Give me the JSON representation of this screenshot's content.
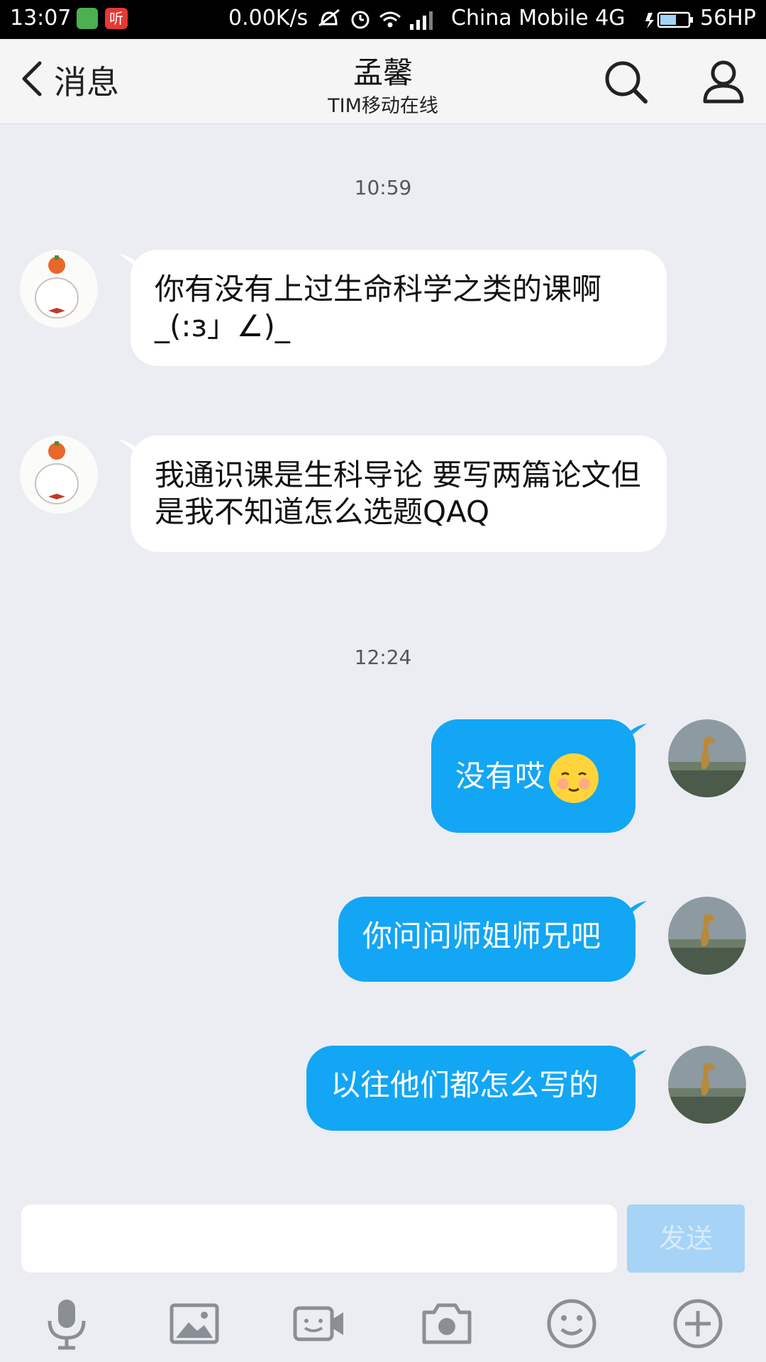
{
  "status_bar": {
    "time": "13:07",
    "app2_label": "听",
    "speed": "0.00K/s",
    "carrier": "China Mobile 4G",
    "battery": "56HP"
  },
  "header": {
    "back_label": "消息",
    "title": "孟馨",
    "subtitle": "TIM移动在线"
  },
  "chat": {
    "time1": "10:59",
    "msg1": "你有没有上过生命科学之类的课啊_(:з」∠)_",
    "msg2": "我通识课是生科导论 要写两篇论文但是我不知道怎么选题QAQ",
    "time2": "12:24",
    "msg3": "没有哎",
    "msg4": "你问问师姐师兄吧",
    "msg5": "以往他们都怎么写的"
  },
  "input": {
    "value": "",
    "send_label": "发送"
  },
  "colors": {
    "accent": "#12a6f5",
    "background": "#ebedf2",
    "send_disabled": "#a7d3f7"
  },
  "icons": [
    "back-chevron-icon",
    "search-icon",
    "profile-icon",
    "microphone-icon",
    "image-icon",
    "video-call-icon",
    "camera-icon",
    "emoji-icon",
    "plus-icon"
  ]
}
